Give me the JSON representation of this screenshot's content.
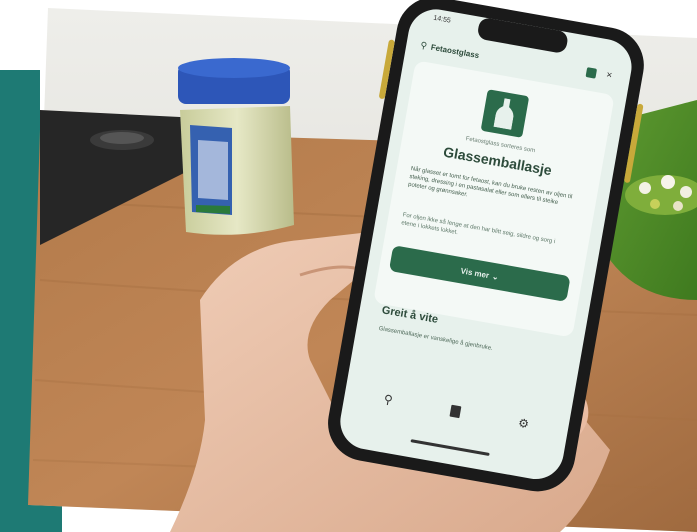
{
  "colors": {
    "teal_band": "#1e7a74",
    "app_green": "#2b6b4b",
    "app_bg": "#e7f1ec"
  },
  "phone": {
    "status_time": "14:55",
    "search_query": "Fetaostglass",
    "sorting_subtitle": "Fetaostglass sorteres som",
    "category_title": "Glassemballasje",
    "paragraph_1": "Når glasset er tomt for fetaost, kan du bruke resten av oljen til steking, dressing i en pastasalat eller som ellers til steike poteter og grønnsaker.",
    "paragraph_2": "For oljen ikke så lenge at den har blitt seig, sildre og sorg i etene i lokkets lokket.",
    "read_more_button": "Vis mer",
    "section_title": "Greit å vite",
    "section_text": "Glassemballasje er vanskelige å gjenbruke.",
    "nav_icons": [
      "search-icon",
      "bookmark-icon",
      "settings-icon"
    ]
  }
}
